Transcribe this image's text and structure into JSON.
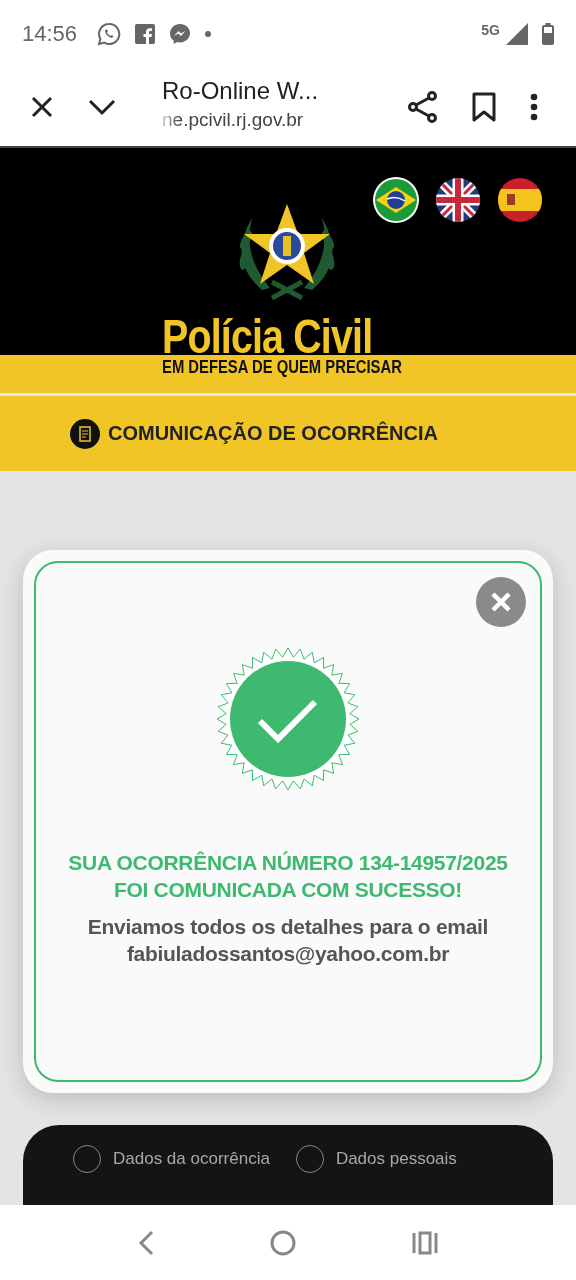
{
  "status_bar": {
    "time": "14:56",
    "network": "5G"
  },
  "browser": {
    "title": "Ro-Online W...",
    "url": "ne.pcivil.rj.gov.br"
  },
  "header": {
    "brand": "Polícia Civil",
    "tagline": "EM DEFESA DE QUEM PRECISAR",
    "languages": [
      {
        "kind": "br",
        "selected": true
      },
      {
        "kind": "gb",
        "selected": false
      },
      {
        "kind": "es",
        "selected": false
      }
    ]
  },
  "nav": {
    "label": "COMUNICAÇÃO DE OCORRÊNCIA"
  },
  "dialog": {
    "heading_lines": [
      "SUA OCORRÊNCIA NÚMERO 134-14957/2025",
      "FOI COMUNICADA COM SUCESSO!"
    ],
    "message_lines": [
      "Enviamos todos os detalhes para o email",
      "fabiuladossantos@yahoo.com.br"
    ]
  },
  "steps": [
    {
      "label": "Dados da ocorrência",
      "checked": false
    },
    {
      "label": "Dados pessoais",
      "checked": false
    }
  ]
}
